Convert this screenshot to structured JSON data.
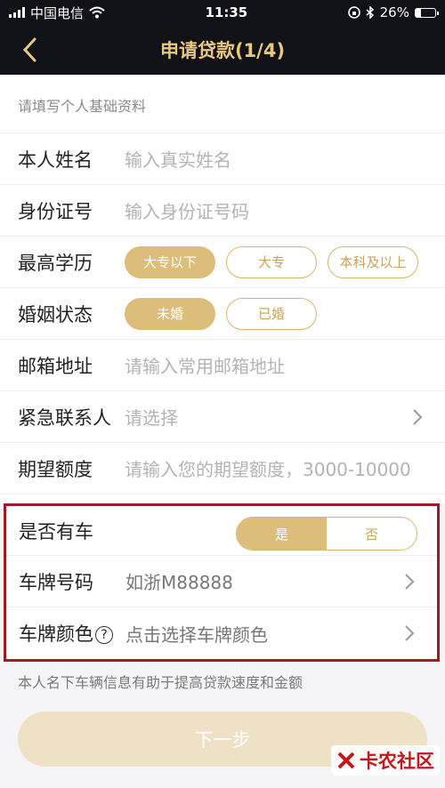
{
  "status_bar": {
    "carrier": "中国电信",
    "time": "11:35",
    "battery": "26%",
    "battery_level": 0.26
  },
  "nav": {
    "title": "申请贷款(1/4)"
  },
  "form": {
    "hint": "请填写个人基础资料",
    "name": {
      "label": "本人姓名",
      "placeholder": "输入真实姓名"
    },
    "id_number": {
      "label": "身份证号",
      "placeholder": "输入身份证号码"
    },
    "education": {
      "label": "最高学历",
      "options": [
        "大专以下",
        "大专",
        "本科及以上"
      ],
      "selected": "大专以下"
    },
    "marital": {
      "label": "婚姻状态",
      "options": [
        "未婚",
        "已婚"
      ],
      "selected": "未婚"
    },
    "email": {
      "label": "邮箱地址",
      "placeholder": "请输入常用邮箱地址"
    },
    "emergency": {
      "label": "紧急联系人",
      "placeholder": "请选择"
    },
    "amount": {
      "label": "期望额度",
      "placeholder": "请输入您的期望额度，3000-10000"
    },
    "has_car": {
      "label": "是否有车",
      "yes": "是",
      "no": "否",
      "selected": "是"
    },
    "plate": {
      "label": "车牌号码",
      "value": "如浙M88888"
    },
    "plate_color": {
      "label": "车牌颜色",
      "help_icon": "?",
      "placeholder": "点击选择车牌颜色"
    }
  },
  "footnote": "本人名下车辆信息有助于提高贷款速度和金额",
  "next_button": "下一步",
  "watermark": "卡农社区",
  "colors": {
    "gold": "#dcbd7a",
    "nav_bg": "#111118",
    "title": "#e9c77e",
    "highlight": "#9b1d20"
  }
}
